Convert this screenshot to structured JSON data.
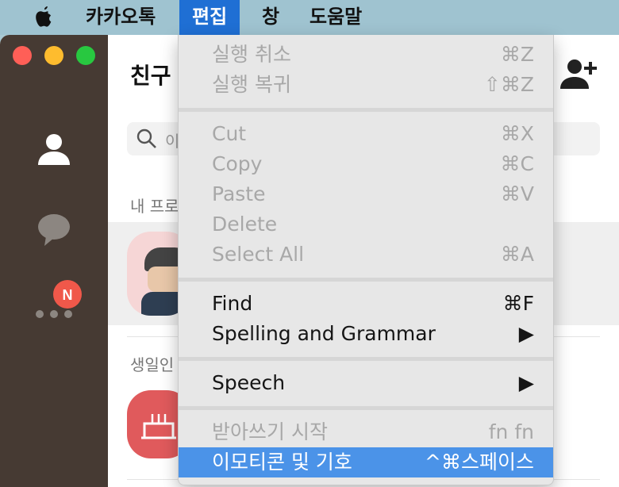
{
  "menubar": {
    "apple_icon": "apple-icon",
    "app_name": "카카오톡",
    "menus": [
      "편집",
      "창",
      "도움말"
    ],
    "active_menu": "편집"
  },
  "window": {
    "traffic_lights": {
      "close": "#ff5f57",
      "minimize": "#febc2e",
      "zoom": "#28c840"
    },
    "sidebar": {
      "items": [
        {
          "icon": "person-icon"
        },
        {
          "icon": "chat-bubble-icon"
        },
        {
          "icon": "more-icon",
          "badge": "N"
        }
      ]
    },
    "main": {
      "title": "친구",
      "search_placeholder": "이",
      "section_profile": "내 프로",
      "section_birthday": "생일인",
      "add_friend_icon": "add-friend-icon"
    }
  },
  "edit_menu": {
    "items": [
      {
        "label": "실행 취소",
        "shortcut": "⌘Z",
        "enabled": false
      },
      {
        "label": "실행 복귀",
        "shortcut": "⇧⌘Z",
        "enabled": false
      },
      {
        "label": "Cut",
        "shortcut": "⌘X",
        "enabled": false
      },
      {
        "label": "Copy",
        "shortcut": "⌘C",
        "enabled": false
      },
      {
        "label": "Paste",
        "shortcut": "⌘V",
        "enabled": false
      },
      {
        "label": "Delete",
        "shortcut": "",
        "enabled": false
      },
      {
        "label": "Select All",
        "shortcut": "⌘A",
        "enabled": false
      },
      {
        "label": "Find",
        "shortcut": "⌘F",
        "enabled": true
      },
      {
        "label": "Spelling and Grammar",
        "shortcut": "▶",
        "enabled": true
      },
      {
        "label": "Speech",
        "shortcut": "▶",
        "enabled": true
      },
      {
        "label": "받아쓰기 시작",
        "shortcut": "fn fn",
        "enabled": false
      },
      {
        "label": "이모티콘 및 기호",
        "shortcut": "^⌘스페이스",
        "enabled": true,
        "highlighted": true
      }
    ]
  },
  "colors": {
    "menubar_bg": "#9fc3d0",
    "active_menu_bg": "#1f6fd4",
    "highlight_bg": "#4b93e8",
    "sidebar_bg": "#463a33",
    "badge_bg": "#f0584a"
  }
}
